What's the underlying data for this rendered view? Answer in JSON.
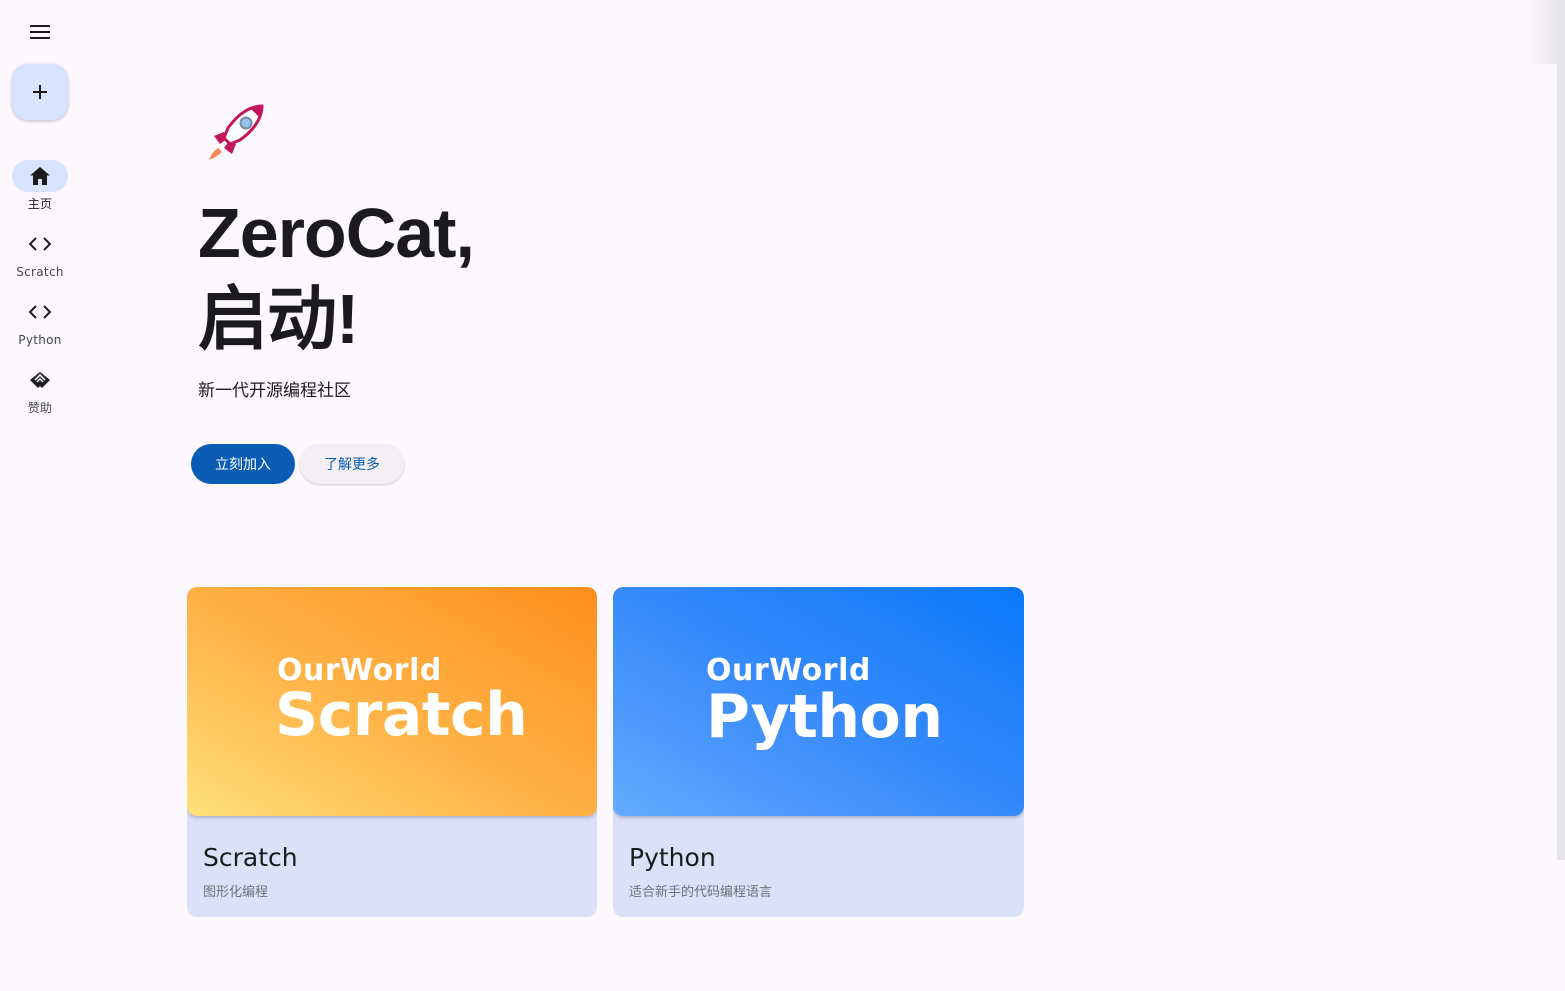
{
  "rail": {
    "items": [
      {
        "label": "主页",
        "icon": "home-icon",
        "active": true
      },
      {
        "label": "Scratch",
        "icon": "code-icon",
        "active": false
      },
      {
        "label": "Python",
        "icon": "code-icon",
        "active": false
      },
      {
        "label": "赞助",
        "icon": "handshake-icon",
        "active": false
      }
    ],
    "fab_icon": "plus-icon",
    "menu_icon": "menu-icon"
  },
  "hero": {
    "icon": "rocket-icon",
    "title_line1": "ZeroCat,",
    "title_line2": "启动!",
    "subtitle": "新一代开源编程社区",
    "primary_button": "立刻加入",
    "secondary_button": "了解更多"
  },
  "cards": [
    {
      "banner_small": "OurWorld",
      "banner_big": "Scratch",
      "title": "Scratch",
      "subtitle": "图形化编程"
    },
    {
      "banner_small": "OurWorld",
      "banner_big": "Python",
      "title": "Python",
      "subtitle": "适合新手的代码编程语言"
    }
  ],
  "colors": {
    "primary": "#0b5cb4",
    "rail_active": "#d7e3ff",
    "card_bg": "#dbe2f8",
    "background": "#fdf8fd"
  }
}
